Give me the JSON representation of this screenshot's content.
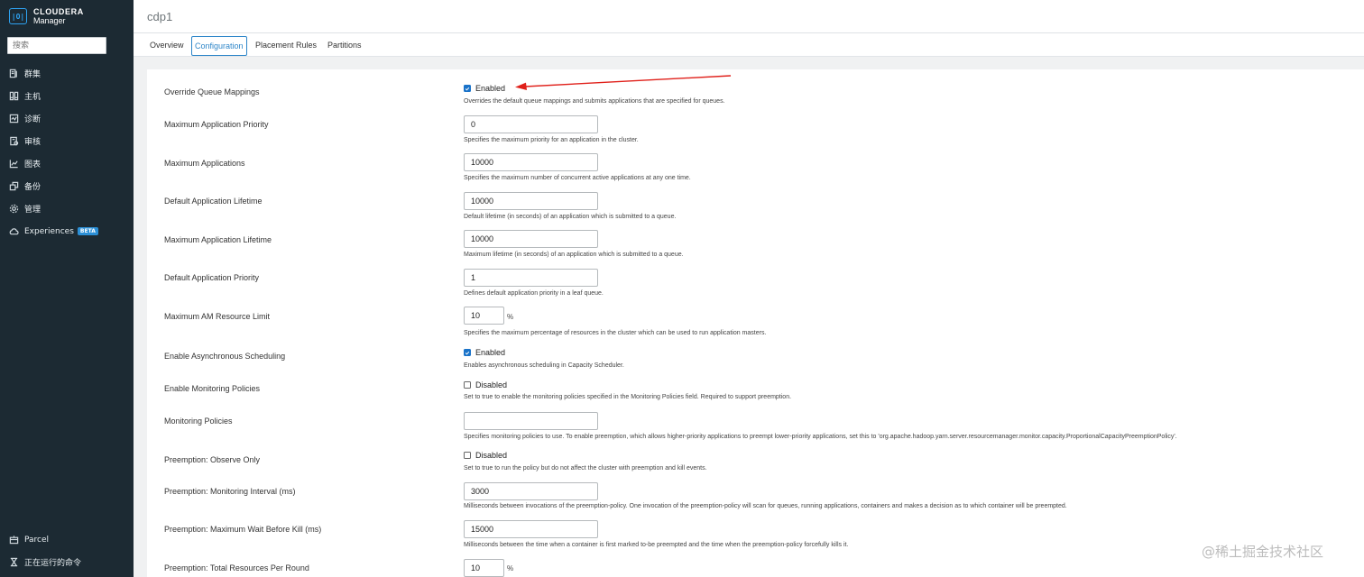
{
  "sidebar": {
    "brand_name": "CLOUDERA",
    "brand_sub": "Manager",
    "search_placeholder": "搜索",
    "items": [
      {
        "label": "群集",
        "icon": "cluster-icon"
      },
      {
        "label": "主机",
        "icon": "hosts-icon"
      },
      {
        "label": "诊断",
        "icon": "diagnostics-icon"
      },
      {
        "label": "审核",
        "icon": "audits-icon"
      },
      {
        "label": "图表",
        "icon": "charts-icon"
      },
      {
        "label": "备份",
        "icon": "backup-icon"
      },
      {
        "label": "管理",
        "icon": "gear-icon"
      },
      {
        "label": "Experiences",
        "icon": "cloud-icon",
        "badge": "BETA"
      }
    ],
    "bottom_items": [
      {
        "label": "Parcel",
        "icon": "parcel-icon"
      },
      {
        "label": "正在运行的命令",
        "icon": "hourglass-icon"
      }
    ]
  },
  "header": {
    "title": "cdp1"
  },
  "tabs": [
    {
      "label": "Overview"
    },
    {
      "label": "Configuration",
      "active": true
    },
    {
      "label": "Placement Rules"
    },
    {
      "label": "Partitions"
    }
  ],
  "config": {
    "override_queue_mappings": {
      "label": "Override Queue Mappings",
      "state": "Enabled",
      "checked": true,
      "desc": "Overrides the default queue mappings and submits applications that are specified for queues."
    },
    "max_app_priority": {
      "label": "Maximum Application Priority",
      "value": "0",
      "desc": "Specifies the maximum priority for an application in the cluster."
    },
    "max_apps": {
      "label": "Maximum Applications",
      "value": "10000",
      "desc": "Specifies the maximum number of concurrent active applications at any one time."
    },
    "default_app_lifetime": {
      "label": "Default Application Lifetime",
      "value": "10000",
      "desc": "Default lifetime (in seconds) of an application which is submitted to a queue."
    },
    "max_app_lifetime": {
      "label": "Maximum Application Lifetime",
      "value": "10000",
      "desc": "Maximum lifetime (in seconds) of an application which is submitted to a queue."
    },
    "default_app_priority": {
      "label": "Default Application Priority",
      "value": "1",
      "desc": "Defines default application priority in a leaf queue."
    },
    "max_am_resource": {
      "label": "Maximum AM Resource Limit",
      "value": "10",
      "unit": "%",
      "desc": "Specifies the maximum percentage of resources in the cluster which can be used to run application masters."
    },
    "async_scheduling": {
      "label": "Enable Asynchronous Scheduling",
      "state": "Enabled",
      "checked": true,
      "desc": "Enables asynchronous scheduling in Capacity Scheduler."
    },
    "monitoring_enable": {
      "label": "Enable Monitoring Policies",
      "state": "Disabled",
      "checked": false,
      "desc": "Set to true to enable the monitoring policies specified in the Monitoring Policies field. Required to support preemption."
    },
    "monitoring_policies": {
      "label": "Monitoring Policies",
      "value": "",
      "desc": "Specifies monitoring policies to use. To enable preemption, which allows higher-priority applications to preempt lower-priority applications, set this to 'org.apache.hadoop.yarn.server.resourcemanager.monitor.capacity.ProportionalCapacityPreemptionPolicy'."
    },
    "preempt_observe": {
      "label": "Preemption: Observe Only",
      "state": "Disabled",
      "checked": false,
      "desc": "Set to true to run the policy but do not affect the cluster with preemption and kill events."
    },
    "preempt_interval": {
      "label": "Preemption: Monitoring Interval (ms)",
      "value": "3000",
      "desc": "Milliseconds between invocations of the preemption-policy. One invocation of the preemption-policy will scan for queues, running applications, containers and makes a decision as to which container will be preempted."
    },
    "preempt_wait": {
      "label": "Preemption: Maximum Wait Before Kill (ms)",
      "value": "15000",
      "desc": "Milliseconds between the time when a container is first marked to-be preempted and the time when the preemption-policy forcefully kills it."
    },
    "preempt_total": {
      "label": "Preemption: Total Resources Per Round",
      "value": "10",
      "unit": "%"
    }
  },
  "watermark": "@稀土掘金技术社区",
  "colors": {
    "sidebar_bg": "#1c2a33",
    "accent": "#2e86c9",
    "arrow": "#e0201a"
  }
}
